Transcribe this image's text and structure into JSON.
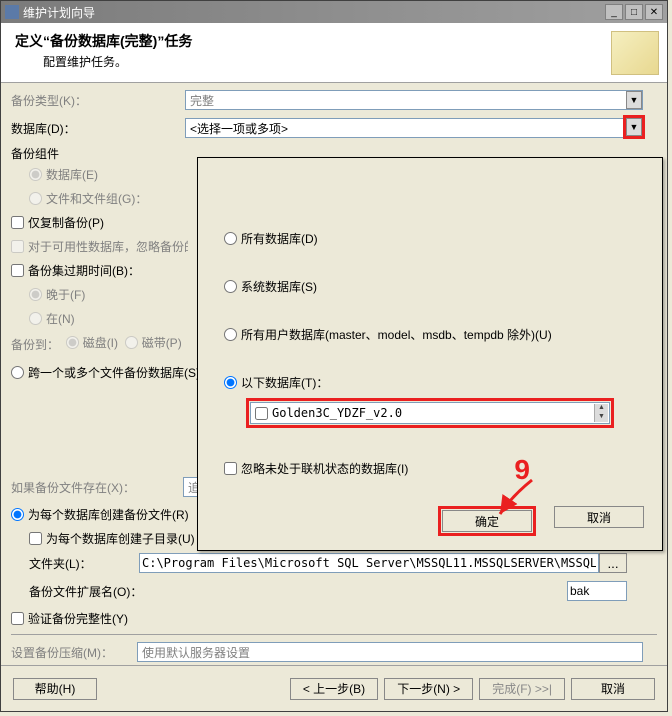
{
  "window": {
    "title": "维护计划向导"
  },
  "header": {
    "title": "定义“备份数据库(完整)”任务",
    "subtitle": "配置维护任务。"
  },
  "fields": {
    "backup_type_label": "备份类型(K)：",
    "backup_type_value": "完整",
    "database_label": "数据库(D)：",
    "database_value": "<选择一项或多项>",
    "backup_component_label": "备份组件",
    "component_db": "数据库(E)",
    "component_filegroup": "文件和文件组(G)：",
    "copy_only": "仅复制备份(P)",
    "avail_replica": "对于可用性数据库，忽略备份的副本优先级和主副本上的备份(G)",
    "expire_set": "备份集过期时间(B)：",
    "expire_after": "晚于(F)",
    "expire_on": "在(N)",
    "backup_to_label": "备份到：",
    "disk": "磁盘(I)",
    "tape": "磁带(P)",
    "across_files": "跨一个或多个文件备份数据库(S)：",
    "if_exists_label": "如果备份文件存在(X)：",
    "if_exists_value": "追加",
    "per_db_file": "为每个数据库创建备份文件(R)",
    "per_db_subdir": "为每个数据库创建子目录(U)",
    "folder_label": "文件夹(L)：",
    "folder_value": "C:\\Program Files\\Microsoft SQL Server\\MSSQL11.MSSQLSERVER\\MSSQL\\Backup",
    "ext_label": "备份文件扩展名(O)：",
    "ext_value": "bak",
    "verify": "验证备份完整性(Y)",
    "compress_label": "设置备份压缩(M)：",
    "compress_value": "使用默认服务器设置",
    "browse": "..."
  },
  "popup": {
    "all_db": "所有数据库(D)",
    "sys_db": "系统数据库(S)",
    "user_db": "所有用户数据库(master、model、msdb、tempdb 除外)(U)",
    "these_db": "以下数据库(T)：",
    "db_item": "Golden3C_YDZF_v2.0",
    "ignore_offline": "忽略未处于联机状态的数据库(I)",
    "ok": "确定",
    "cancel": "取消"
  },
  "buttons": {
    "help": "帮助(H)",
    "back": "< 上一步(B)",
    "next": "下一步(N) >",
    "finish": "完成(F) >>|",
    "cancel": "取消"
  },
  "annotation": {
    "num": "9"
  }
}
